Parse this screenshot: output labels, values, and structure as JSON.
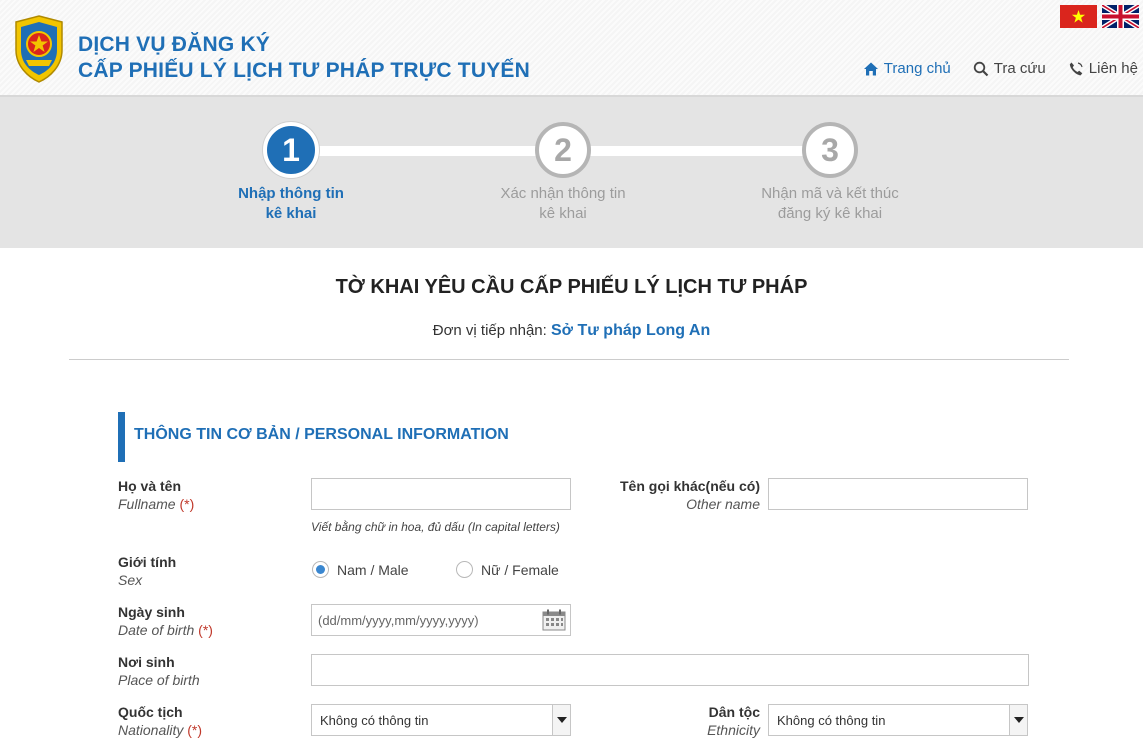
{
  "header": {
    "brand_line1": "DỊCH VỤ ĐĂNG KÝ",
    "brand_line2": "CẤP PHIẾU LÝ LỊCH TƯ PHÁP TRỰC TUYẾN",
    "nav": {
      "home": "Trang chủ",
      "lookup": "Tra cứu",
      "contact": "Liên hệ"
    },
    "colors": {
      "brand": "#1f6fb6",
      "flag_vn": "#da251d",
      "star": "#ffff00"
    }
  },
  "stepper": {
    "steps": [
      {
        "number": "1",
        "line1": "Nhập thông tin",
        "line2": "kê khai",
        "state": "active"
      },
      {
        "number": "2",
        "line1": "Xác nhận thông tin",
        "line2": "kê khai",
        "state": "inactive"
      },
      {
        "number": "3",
        "line1": "Nhận mã và kết thúc",
        "line2": "đăng ký kê khai",
        "state": "inactive"
      }
    ]
  },
  "form": {
    "title": "TỜ KHAI YÊU CẦU CẤP PHIẾU LÝ LỊCH TƯ PHÁP",
    "agency_label": "Đơn vị tiếp nhận:",
    "agency_name": "Sở Tư pháp Long An",
    "section_title": "THÔNG TIN CƠ BẢN / PERSONAL INFORMATION",
    "required_mark": "(*)",
    "fullname": {
      "label_vi": "Họ và tên",
      "label_en": "Fullname",
      "value": "",
      "hint": "Viết bằng chữ in hoa, đủ dấu (In capital letters)"
    },
    "other_name": {
      "label_vi": "Tên gọi khác(nếu có)",
      "label_en": "Other name",
      "value": ""
    },
    "gender": {
      "label_vi": "Giới tính",
      "label_en": "Sex",
      "options": [
        "Nam / Male",
        "Nữ / Female"
      ],
      "selected": "Nam / Male"
    },
    "dob": {
      "label_vi": "Ngày sinh",
      "label_en": "Date of birth",
      "placeholder": "(dd/mm/yyyy,mm/yyyy,yyyy)"
    },
    "birthplace": {
      "label_vi": "Nơi sinh",
      "label_en": "Place of birth",
      "value": ""
    },
    "nationality": {
      "label_vi": "Quốc tịch",
      "label_en": "Nationality",
      "selected": "Không có thông tin"
    },
    "ethnicity": {
      "label_vi": "Dân tộc",
      "label_en": "Ethnicity",
      "selected": "Không có thông tin"
    }
  }
}
